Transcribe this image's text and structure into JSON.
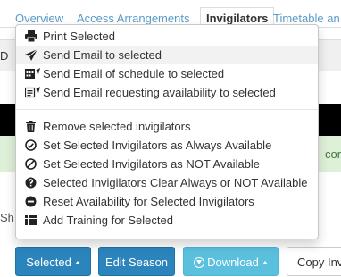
{
  "tabs": [
    {
      "label": "Overview"
    },
    {
      "label": "Access Arrangements"
    },
    {
      "label": "Invigilators"
    },
    {
      "label": "Timetable an"
    }
  ],
  "background": {
    "strip_letter": "D",
    "green_text": "cor",
    "side_text": "Sh"
  },
  "menu": {
    "group1": [
      {
        "label": "Print Selected",
        "icon": "print-icon"
      },
      {
        "label": "Send Email to selected",
        "icon": "send-icon"
      },
      {
        "label": "Send Email of schedule to selected",
        "icon": "calendar-send-icon"
      },
      {
        "label": "Send Email requesting availability to selected",
        "icon": "form-send-icon"
      }
    ],
    "group2": [
      {
        "label": "Remove selected invigilators",
        "icon": "trash-icon"
      },
      {
        "label": "Set Selected Invigilators as Always Available",
        "icon": "check-circle-icon"
      },
      {
        "label": "Set Selected Invigilators as NOT Available",
        "icon": "ban-icon"
      },
      {
        "label": "Selected Invigilators Clear Always or NOT Available",
        "icon": "question-circle-icon"
      },
      {
        "label": "Reset Availability for Selected Invigilators",
        "icon": "minus-circle-icon"
      },
      {
        "label": "Add Training for Selected",
        "icon": "list-icon"
      }
    ]
  },
  "toolbar": {
    "selected_label": "Selected",
    "edit_season_label": "Edit Season",
    "download_label": "Download",
    "copy_label": "Copy Inv"
  },
  "colors": {
    "primary": "#2c84bd",
    "info": "#5bc0de",
    "tab_link": "#5a9bc8",
    "success_bg": "#dff0d8"
  }
}
